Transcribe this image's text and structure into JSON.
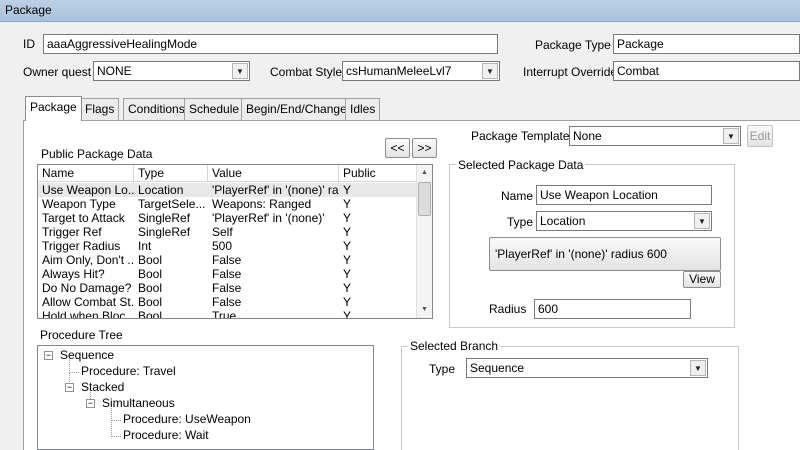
{
  "window": {
    "title": "Package"
  },
  "header": {
    "id_label": "ID",
    "id_value": "aaaAggressiveHealingMode",
    "owner_quest_label": "Owner quest",
    "owner_quest_value": "NONE",
    "combat_style_label": "Combat Style",
    "combat_style_value": "csHumanMeleeLvl7",
    "package_type_label": "Package Type",
    "package_type_value": "Package",
    "interrupt_override_label": "Interrupt Override",
    "interrupt_override_value": "Combat"
  },
  "tabs": [
    {
      "label": "Package"
    },
    {
      "label": "Flags"
    },
    {
      "label": "Conditions"
    },
    {
      "label": "Schedule"
    },
    {
      "label": "Begin/End/Change"
    },
    {
      "label": "Idles"
    }
  ],
  "public_data": {
    "title": "Public Package Data",
    "prev_label": "<<",
    "next_label": ">>",
    "columns": [
      "Name",
      "Type",
      "Value",
      "Public"
    ],
    "rows": [
      [
        "Use Weapon Lo...",
        "Location",
        "'PlayerRef' in '(none)' ra...",
        "Y"
      ],
      [
        "Weapon Type",
        "TargetSele...",
        "Weapons: Ranged",
        "Y"
      ],
      [
        "Target to Attack",
        "SingleRef",
        "'PlayerRef' in '(none)'",
        "Y"
      ],
      [
        "Trigger Ref",
        "SingleRef",
        "Self",
        "Y"
      ],
      [
        "Trigger Radius",
        "Int",
        "500",
        "Y"
      ],
      [
        "Aim Only, Don't ...",
        "Bool",
        "False",
        "Y"
      ],
      [
        "Always Hit?",
        "Bool",
        "False",
        "Y"
      ],
      [
        "Do No Damage?",
        "Bool",
        "False",
        "Y"
      ],
      [
        "Allow Combat St...",
        "Bool",
        "False",
        "Y"
      ],
      [
        "Hold when Bloc...",
        "Bool",
        "True",
        "Y"
      ]
    ]
  },
  "template": {
    "label": "Package Template",
    "value": "None",
    "edit_label": "Edit"
  },
  "selected_data": {
    "title": "Selected Package Data",
    "name_label": "Name",
    "name_value": "Use Weapon Location",
    "type_label": "Type",
    "type_value": "Location",
    "location_text": "'PlayerRef' in '(none)' radius 600",
    "view_label": "View",
    "radius_label": "Radius",
    "radius_value": "600"
  },
  "procedure_tree": {
    "title": "Procedure Tree",
    "nodes": [
      "Sequence",
      "Procedure: Travel",
      "Stacked",
      "Simultaneous",
      "Procedure: UseWeapon",
      "Procedure: Wait"
    ]
  },
  "selected_branch": {
    "title": "Selected Branch",
    "type_label": "Type",
    "type_value": "Sequence"
  }
}
